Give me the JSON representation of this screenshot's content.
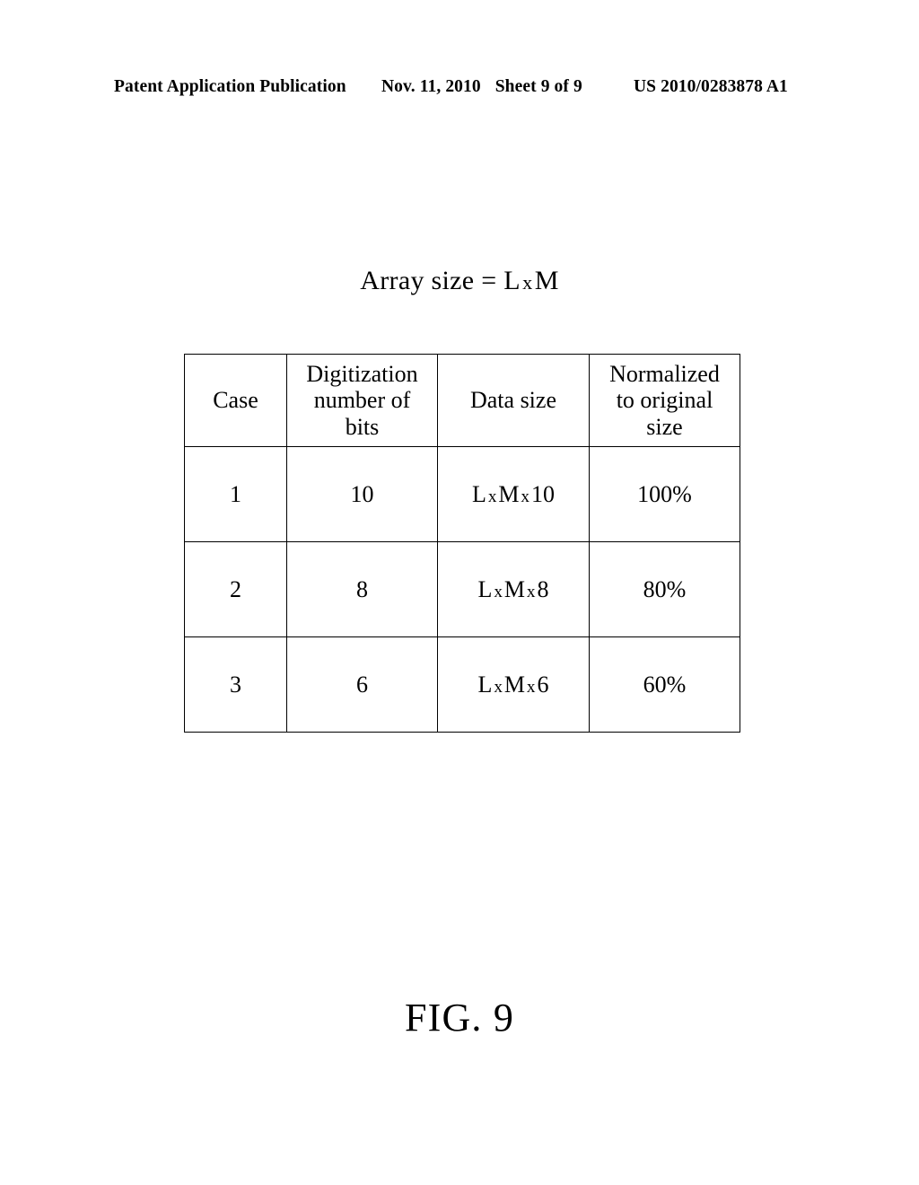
{
  "header": {
    "publication": "Patent Application Publication",
    "date": "Nov. 11, 2010",
    "sheet": "Sheet 9 of 9",
    "patent_number": "US 2010/0283878 A1"
  },
  "figure": {
    "title_prefix": "Array size =",
    "title_operand_a": "L",
    "title_operator": "x",
    "title_operand_b": "M",
    "title_full": "Array size = L x M",
    "caption": "FIG. 9"
  },
  "table": {
    "columns": [
      {
        "id": "case",
        "label": "Case",
        "lines": [
          "Case"
        ]
      },
      {
        "id": "bits",
        "label": "Digitization number of bits",
        "lines": [
          "Digitization",
          "number of",
          "bits"
        ]
      },
      {
        "id": "data_size",
        "label": "Data size",
        "lines": [
          "Data size"
        ]
      },
      {
        "id": "normalized",
        "label": "Normalized to original size",
        "lines": [
          "Normalized",
          "to original",
          "size"
        ]
      }
    ],
    "rows": [
      {
        "case": "1",
        "bits": "10",
        "data_size": "L x M x 10",
        "data_size_parts": {
          "a": "L",
          "op1": "x",
          "b": "M",
          "op2": "x",
          "c": "10"
        },
        "normalized": "100%"
      },
      {
        "case": "2",
        "bits": "8",
        "data_size": "L x M x 8",
        "data_size_parts": {
          "a": "L",
          "op1": "x",
          "b": "M",
          "op2": "x",
          "c": "8"
        },
        "normalized": "80%"
      },
      {
        "case": "3",
        "bits": "6",
        "data_size": "L x M x 6",
        "data_size_parts": {
          "a": "L",
          "op1": "x",
          "b": "M",
          "op2": "x",
          "c": "6"
        },
        "normalized": "60%"
      }
    ]
  },
  "colors": {
    "page_background": "#ffffff",
    "text": "#000000",
    "table_border": "#000000"
  }
}
